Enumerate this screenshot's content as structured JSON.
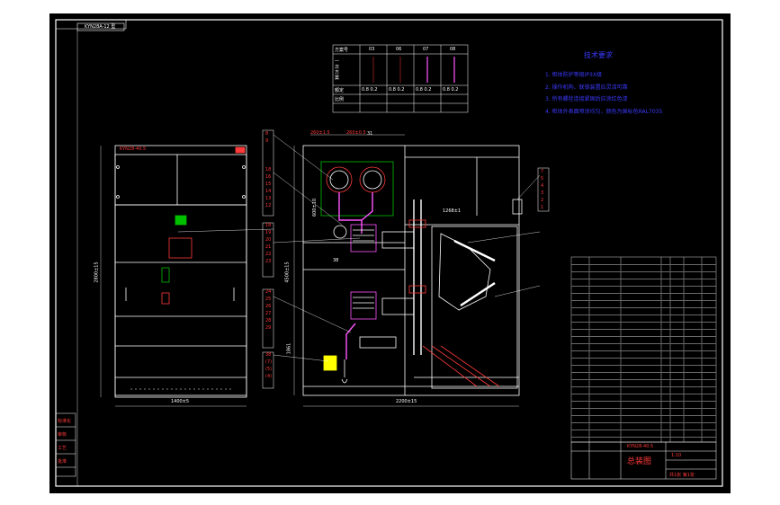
{
  "sheet": {
    "drawing_code": "KYN28A-12 型",
    "front_title": "KYN28-40.5",
    "front_width_dim": "1400±5",
    "front_height_dim": "2800±15",
    "depth_dim": "2200±15",
    "side_height_dim": "4500±15",
    "busbar_dims": [
      "260±1.5",
      "260±0.5"
    ],
    "small_dims": [
      "1268±1",
      "600±10",
      "1861"
    ],
    "callouts_left": [
      "8",
      "9",
      "18",
      "16",
      "15",
      "14",
      "13",
      "12",
      "18",
      "19",
      "20",
      "21",
      "22",
      "23",
      "24",
      "25",
      "26",
      "27",
      "28",
      "29",
      "38",
      "(7)",
      "(5)",
      "(4)"
    ],
    "callouts_top": [
      "31",
      "38"
    ],
    "callouts_right": [
      "7",
      "5",
      "4",
      "3",
      "2",
      "1"
    ]
  },
  "scheme_table": {
    "headers": [
      "方案号",
      "03",
      "06",
      "07",
      "08"
    ],
    "row_labels": [
      "一次方案",
      "额定",
      "比例"
    ],
    "cells": [
      "0.8 0.2",
      "0.8 0.2",
      "0.8 0.2",
      "0.8 0.2"
    ]
  },
  "tech_requirements": {
    "title": "技术要求",
    "items": [
      "1. 柜体防护等级IP3X级",
      "2. 操作机构、联锁装置应灵活可靠",
      "3. 所有螺栓连接紧固后应涂红色漆",
      "4. 柜体外表面喷涂均匀，颜色为国标色RAL7035"
    ]
  },
  "title_block": {
    "product": "KYN28-40.5",
    "drawing_name": "总装图",
    "scale": "1:10",
    "sheet": "共1张 第1张",
    "left_stamps": [
      "标准化",
      "审核",
      "工艺",
      "批准"
    ]
  },
  "colors": {
    "background": "#000000",
    "frame": "#ffffff",
    "annotation": "#ff3a3a",
    "text_blue": "#3a3aff",
    "component": "#ff55ff",
    "highlight_green": "#00c000",
    "frame_border": "#2a2a2a"
  }
}
